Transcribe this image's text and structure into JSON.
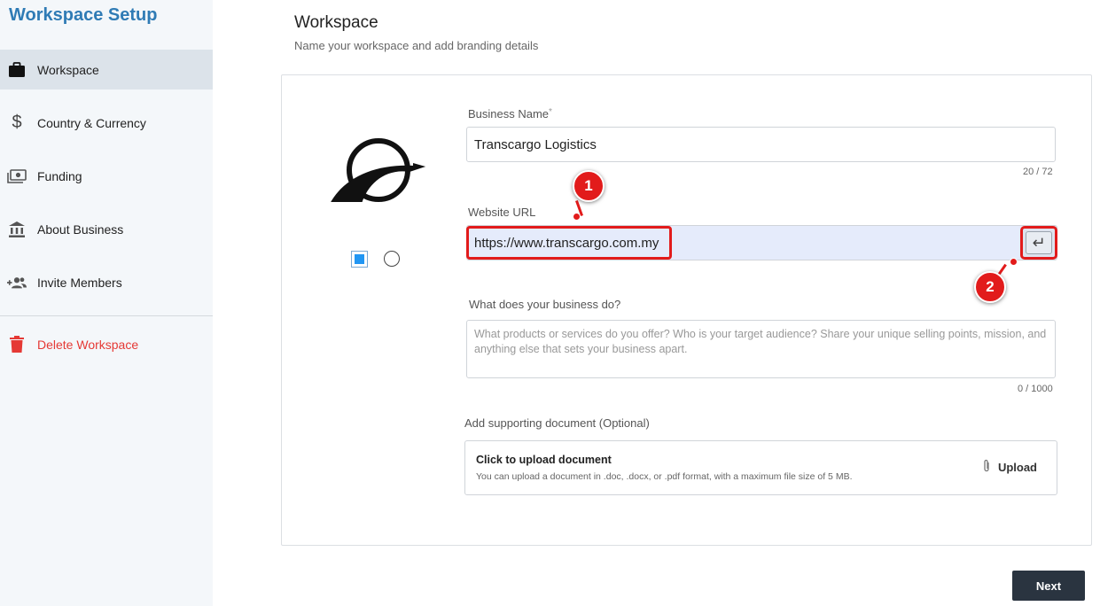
{
  "sidebar": {
    "title": "Workspace Setup",
    "items": [
      {
        "label": "Workspace",
        "icon": "briefcase-icon"
      },
      {
        "label": "Country & Currency",
        "icon": "dollar-icon"
      },
      {
        "label": "Funding",
        "icon": "money-icon"
      },
      {
        "label": "About Business",
        "icon": "bank-icon"
      },
      {
        "label": "Invite Members",
        "icon": "add-group-icon"
      }
    ],
    "delete_label": "Delete Workspace"
  },
  "header": {
    "title": "Workspace",
    "subtitle": "Name your workspace and add branding details"
  },
  "form": {
    "business_name": {
      "label": "Business Name",
      "required_mark": "*",
      "value": "Transcargo Logistics",
      "counter": "20 / 72"
    },
    "website_url": {
      "label": "Website URL",
      "value": "https://www.transcargo.com.my",
      "enter_icon": "↵"
    },
    "description": {
      "label": "What does your business do?",
      "placeholder": "What products or services do you offer? Who is your target audience? Share your unique selling points, mission, and anything else that sets your business apart.",
      "counter": "0 / 1000"
    },
    "document": {
      "label": "Add supporting document (Optional)",
      "title": "Click to upload document",
      "description": "You can upload a document in .doc, .docx, or .pdf format, with a maximum file size of 5 MB.",
      "button": "Upload"
    }
  },
  "annotations": {
    "marker1": "1",
    "marker2": "2"
  },
  "footer": {
    "next_label": "Next"
  },
  "colors": {
    "accent": "#2f7bb5",
    "danger": "#e53935",
    "annotation": "#e21b1b",
    "dark_button": "#2a3440"
  }
}
